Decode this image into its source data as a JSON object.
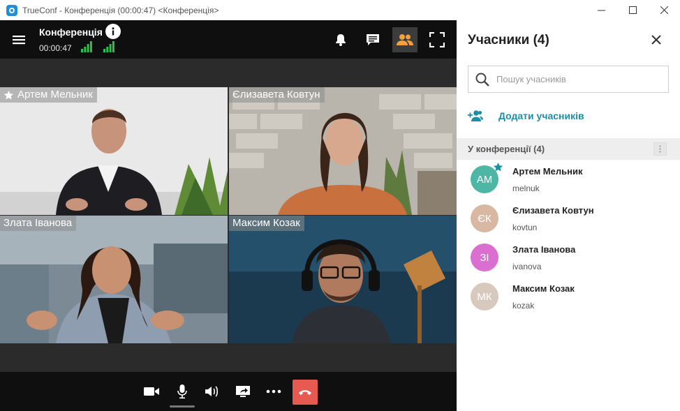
{
  "window": {
    "title": "TrueConf - Конференція (00:00:47) <Конференція>"
  },
  "conference": {
    "name": "Конференція",
    "timer": "00:00:47"
  },
  "participants_tiles": [
    {
      "name": "Артем Мельник",
      "is_owner": true
    },
    {
      "name": "Єлизавета Ковтун",
      "is_owner": false
    },
    {
      "name": "Злата Іванова",
      "is_owner": false
    },
    {
      "name": "Максим Козак",
      "is_owner": false
    }
  ],
  "panel": {
    "title": "Учасники (4)",
    "search_placeholder": "Пошук учасників",
    "add_label": "Додати учасників",
    "section_label": "У конференції (4)",
    "participants": [
      {
        "initials": "AM",
        "name": "Артем Мельник",
        "login": "melnuk",
        "avatar_color": "#4db6a4",
        "owner": true
      },
      {
        "initials": "ЄК",
        "name": "Єлизавета Ковтун",
        "login": "kovtun",
        "avatar_color": "#d8b7a3",
        "owner": false
      },
      {
        "initials": "ЗІ",
        "name": "Злата Іванова",
        "login": "ivanova",
        "avatar_color": "#db6fd1",
        "owner": false
      },
      {
        "initials": "МК",
        "name": "Максим Козак",
        "login": "kozak",
        "avatar_color": "#d7c9bd",
        "owner": false
      }
    ]
  },
  "colors": {
    "accent": "#1a8fa5",
    "people_active": "#f5a03c",
    "signal": "#2ec04a",
    "end_call": "#e65a52",
    "owner_star": "#1a8fa5"
  }
}
